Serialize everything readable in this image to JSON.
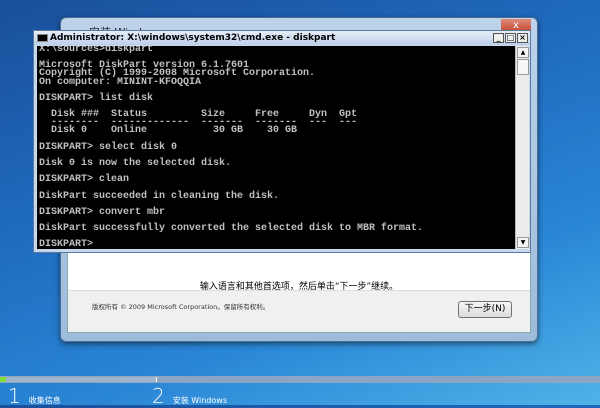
{
  "setup": {
    "title": "安装 Windows",
    "close": "x",
    "message": "输入语言和其他首选项，然后单击“下一步”继续。",
    "copyright": "版权所有 © 2009 Microsoft Corporation。保留所有权利。",
    "next_button": "下一步(N)"
  },
  "cmd": {
    "title": "Administrator: X:\\windows\\system32\\cmd.exe - diskpart",
    "minimize": "_",
    "maximize": "□",
    "close": "×",
    "lines": [
      "X:\\sources>diskpart",
      "",
      "Microsoft DiskPart version 6.1.7601",
      "Copyright (C) 1999-2008 Microsoft Corporation.",
      "On computer: MININT-KFOQQIA",
      "",
      "DISKPART> list disk",
      "",
      "  Disk ###  Status         Size     Free     Dyn  Gpt",
      "  --------  -------------  -------  -------  ---  ---",
      "  Disk 0    Online           30 GB    30 GB",
      "",
      "DISKPART> select disk 0",
      "",
      "Disk 0 is now the selected disk.",
      "",
      "DISKPART> clean",
      "",
      "DiskPart succeeded in cleaning the disk.",
      "",
      "DISKPART> convert mbr",
      "",
      "DiskPart successfully converted the selected disk to MBR format.",
      "",
      "DISKPART> "
    ]
  },
  "steps": [
    {
      "num": "1",
      "label": "收集信息"
    },
    {
      "num": "2",
      "label": "安装 Windows"
    }
  ],
  "progress": {
    "current_step": 1,
    "fraction_of_step": 0.04
  }
}
